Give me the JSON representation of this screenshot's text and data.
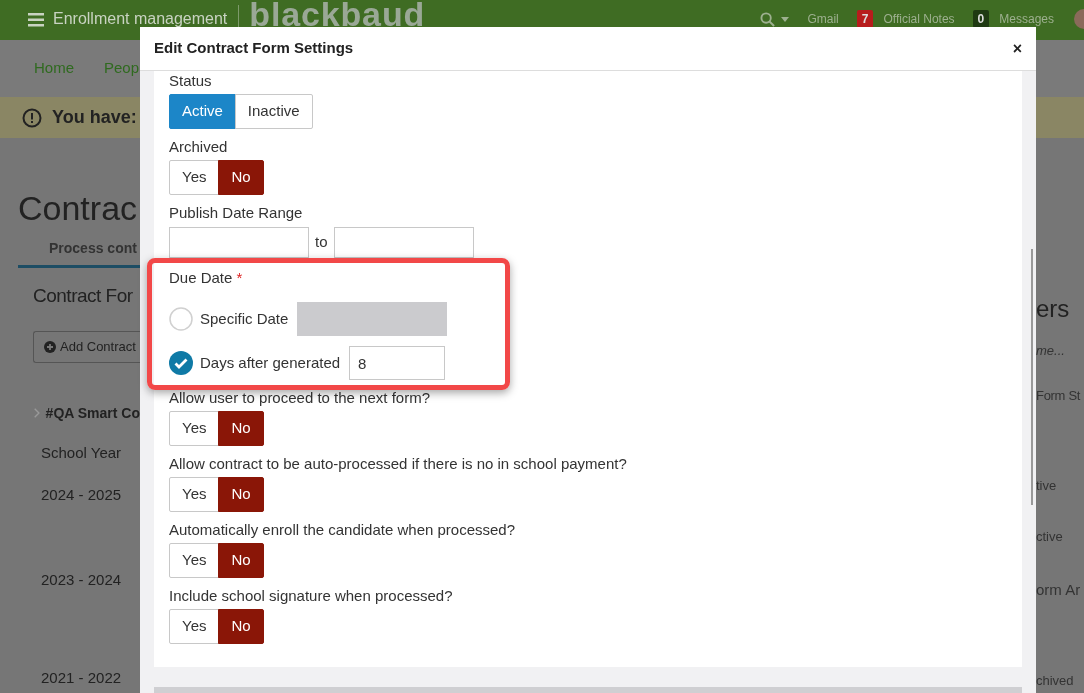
{
  "app_header": {
    "title": "Enrollment management",
    "logo": "blackbaud",
    "links": [
      {
        "label": "Gmail"
      },
      {
        "label": "Official Notes",
        "count": "7",
        "color": "#b71c1c"
      },
      {
        "label": "Messages",
        "count": "0",
        "color": "#1f3a12"
      }
    ]
  },
  "nav": [
    "Home",
    "Peop"
  ],
  "banner": {
    "text": "You have:"
  },
  "page": {
    "title": "Contrac",
    "tab": "Process cont",
    "panel_title": "Contract For",
    "add_button": "Add Contract",
    "group": "#QA Smart Co",
    "column": "School Year",
    "years": [
      "2024 - 2025",
      "2023 - 2024",
      "2021 - 2022"
    ]
  },
  "side_panel": {
    "title": "ers",
    "search_placeholder": "me...",
    "heading": "Form St",
    "states": [
      "tive",
      "ctive"
    ],
    "heading_2": "orm Ar",
    "state_3": "chived"
  },
  "modal": {
    "title": "Edit Contract Form Settings",
    "close": "×",
    "fields": [
      {
        "kind": "status",
        "label": "Status",
        "options": [
          {
            "label": "Active",
            "selected": true
          },
          {
            "label": "Inactive",
            "selected": false
          }
        ]
      },
      {
        "kind": "toggle",
        "label": "Archived",
        "options": [
          {
            "label": "Yes",
            "selected": false
          },
          {
            "label": "No",
            "selected": true
          }
        ]
      },
      {
        "kind": "range",
        "label": "Publish Date Range",
        "separator": "to"
      },
      {
        "kind": "choice",
        "label": "Due Date",
        "required_mark": "*",
        "highlighted": true,
        "options": [
          {
            "label": "Specific Date",
            "selected": false
          },
          {
            "label": "Days after generated",
            "selected": true,
            "value": "8"
          }
        ]
      },
      {
        "kind": "toggle",
        "label": "Allow user to proceed to the next form?",
        "options": [
          {
            "label": "Yes",
            "selected": false
          },
          {
            "label": "No",
            "selected": true
          }
        ]
      },
      {
        "kind": "toggle",
        "label": "Allow contract to be auto-processed if there is no in school payment?",
        "options": [
          {
            "label": "Yes",
            "selected": false
          },
          {
            "label": "No",
            "selected": true
          }
        ]
      },
      {
        "kind": "toggle",
        "label": "Automatically enroll the candidate when processed?",
        "options": [
          {
            "label": "Yes",
            "selected": false
          },
          {
            "label": "No",
            "selected": true
          }
        ]
      },
      {
        "kind": "toggle",
        "label": "Include school signature when processed?",
        "options": [
          {
            "label": "Yes",
            "selected": false
          },
          {
            "label": "No",
            "selected": true
          }
        ]
      }
    ]
  }
}
